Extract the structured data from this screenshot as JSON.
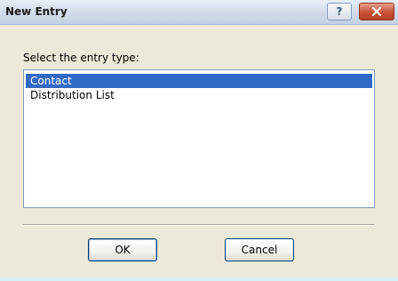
{
  "window": {
    "title": "New Entry"
  },
  "titlebar": {
    "help_button_label": "?",
    "close_button_label": "×"
  },
  "dialog": {
    "prompt": "Select the entry type:",
    "entry_types": [
      {
        "label": "Contact",
        "selected": true
      },
      {
        "label": "Distribution List",
        "selected": false
      }
    ]
  },
  "buttons": {
    "ok_label": "OK",
    "cancel_label": "Cancel"
  },
  "colors": {
    "selection_bg": "#316ac5",
    "close_button": "#c74f34",
    "dialog_bg": "#ece9d8"
  },
  "icons": {
    "help": "question-mark-icon",
    "close": "close-icon"
  }
}
